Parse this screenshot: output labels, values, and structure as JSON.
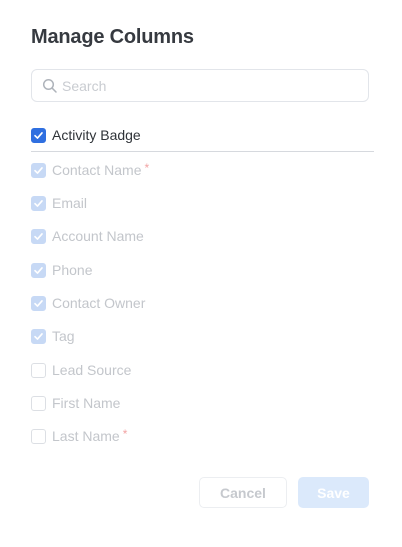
{
  "dialog": {
    "title": "Manage Columns",
    "search": {
      "placeholder": "Search",
      "value": "",
      "icon": "search-icon"
    },
    "columns": [
      {
        "label": "Activity Badge",
        "checked": true,
        "disabled": false,
        "required": false
      },
      {
        "label": "Contact Name",
        "checked": true,
        "disabled": true,
        "required": true
      },
      {
        "label": "Email",
        "checked": true,
        "disabled": true,
        "required": false
      },
      {
        "label": "Account Name",
        "checked": true,
        "disabled": true,
        "required": false
      },
      {
        "label": "Phone",
        "checked": true,
        "disabled": true,
        "required": false
      },
      {
        "label": "Contact Owner",
        "checked": true,
        "disabled": true,
        "required": false
      },
      {
        "label": "Tag",
        "checked": true,
        "disabled": true,
        "required": false
      },
      {
        "label": "Lead Source",
        "checked": false,
        "disabled": true,
        "required": false
      },
      {
        "label": "First Name",
        "checked": false,
        "disabled": true,
        "required": false
      },
      {
        "label": "Last Name",
        "checked": false,
        "disabled": true,
        "required": true
      }
    ],
    "required_marker": "*",
    "buttons": {
      "cancel": "Cancel",
      "save": "Save"
    },
    "colors": {
      "accent": "#2f6fe0",
      "accent_disabled": "#c7d9f5",
      "required": "#f2a3a3"
    }
  }
}
